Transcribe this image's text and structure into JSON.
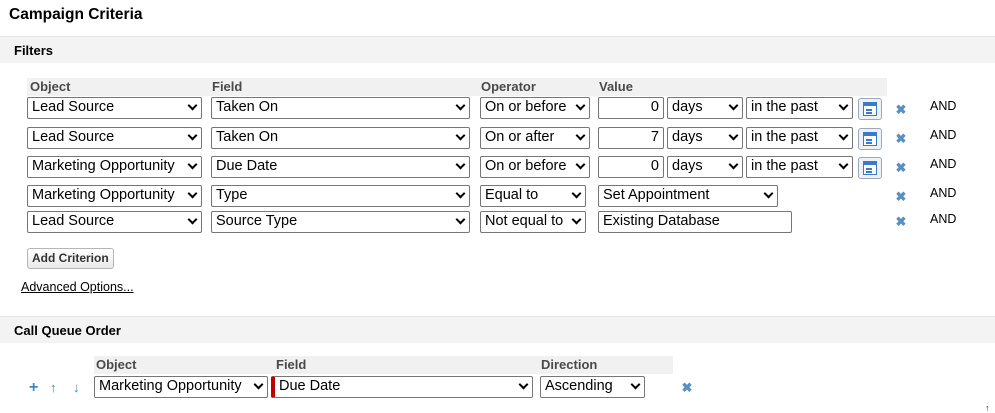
{
  "page": {
    "title": "Campaign Criteria"
  },
  "filters": {
    "section_title": "Filters",
    "columns": {
      "object": "Object",
      "field": "Field",
      "operator": "Operator",
      "value": "Value"
    },
    "rows": [
      {
        "object": "Lead Source",
        "field": "Taken On",
        "operator": "On or before",
        "value": "0",
        "unit": "days",
        "direction": "in the past",
        "conjunction": "AND"
      },
      {
        "object": "Lead Source",
        "field": "Taken On",
        "operator": "On or after",
        "value": "7",
        "unit": "days",
        "direction": "in the past",
        "conjunction": "AND"
      },
      {
        "object": "Marketing Opportunity",
        "field": "Due Date",
        "operator": "On or before",
        "value": "0",
        "unit": "days",
        "direction": "in the past",
        "conjunction": "AND"
      },
      {
        "object": "Marketing Opportunity",
        "field": "Type",
        "operator": "Equal to",
        "value": "Set Appointment",
        "conjunction": "AND"
      },
      {
        "object": "Lead Source",
        "field": "Source Type",
        "operator": "Not equal to",
        "value": "Existing Database",
        "conjunction": "AND"
      }
    ],
    "add_criterion_label": "Add Criterion",
    "advanced_options_label": "Advanced Options..."
  },
  "call_queue": {
    "section_title": "Call Queue Order",
    "columns": {
      "object": "Object",
      "field": "Field",
      "direction": "Direction"
    },
    "row": {
      "object": "Marketing Opportunity",
      "field": "Due Date",
      "direction": "Ascending"
    }
  },
  "icons": {
    "remove": "close-icon",
    "calendar": "calendar-picker-icon",
    "add": "plus-icon",
    "move_up": "arrow-up-icon",
    "move_down": "arrow-down-icon"
  },
  "colors": {
    "accent": "#3c87c8",
    "required_marker": "#c00000",
    "header_bg": "#f3f3f3"
  },
  "glyphs": {
    "remove": "✖",
    "add": "+",
    "up": "↑",
    "down": "↓",
    "cursor": "↑"
  }
}
